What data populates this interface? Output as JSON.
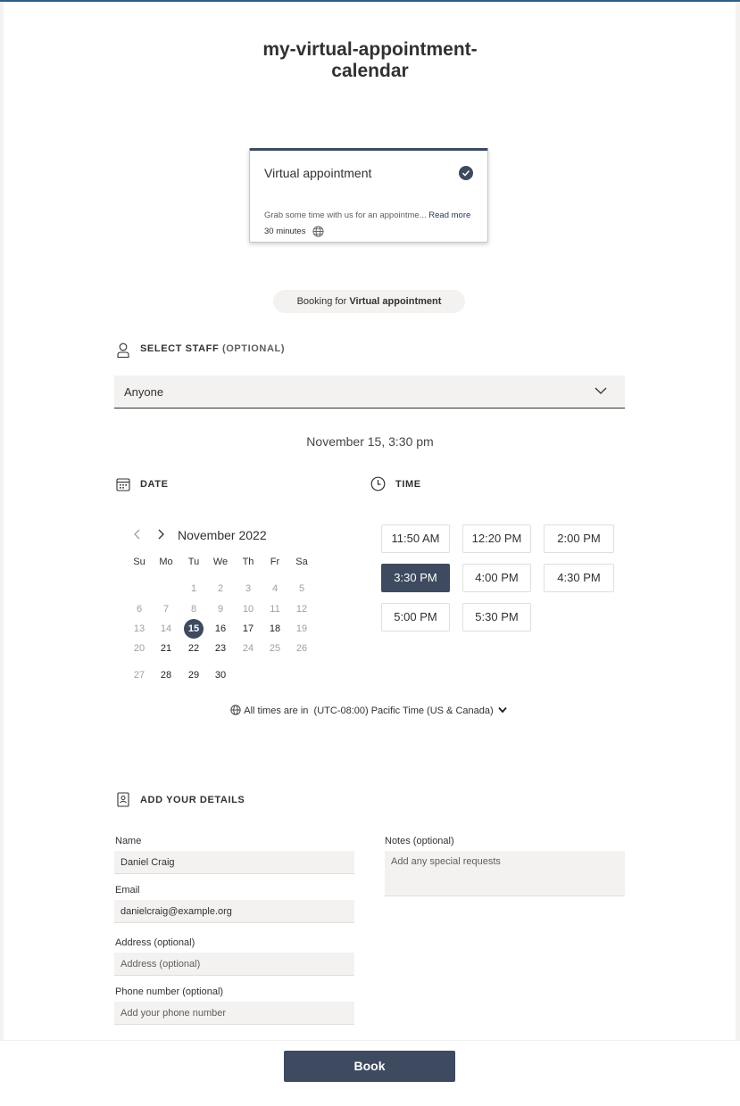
{
  "page": {
    "title_line1": "my-virtual-appointment-",
    "title_line2": "calendar"
  },
  "service": {
    "name": "Virtual appointment",
    "description": "Grab some time with us for an appointme...",
    "read_more": "Read more",
    "duration": "30 minutes",
    "selected": true
  },
  "booking_for": {
    "prefix": "Booking for",
    "service": "Virtual appointment"
  },
  "staff": {
    "heading": "SELECT STAFF",
    "heading_optional": "(OPTIONAL)",
    "value": "Anyone"
  },
  "selected_datetime": "November 15, 3:30 pm",
  "date_section": {
    "heading": "DATE"
  },
  "time_section": {
    "heading": "TIME"
  },
  "calendar": {
    "month": "November 2022",
    "weekdays": [
      "Su",
      "Mo",
      "Tu",
      "We",
      "Th",
      "Fr",
      "Sa"
    ],
    "selected_day": "15",
    "weeks": [
      [
        null,
        null,
        {
          "d": "1",
          "a": false
        },
        {
          "d": "2",
          "a": false
        },
        {
          "d": "3",
          "a": false
        },
        {
          "d": "4",
          "a": false
        },
        {
          "d": "5",
          "a": false
        }
      ],
      [
        {
          "d": "6",
          "a": false
        },
        {
          "d": "7",
          "a": false
        },
        {
          "d": "8",
          "a": false
        },
        {
          "d": "9",
          "a": false
        },
        {
          "d": "10",
          "a": false
        },
        {
          "d": "11",
          "a": false
        },
        {
          "d": "12",
          "a": false
        }
      ],
      [
        {
          "d": "13",
          "a": false
        },
        {
          "d": "14",
          "a": false
        },
        {
          "d": "15",
          "a": true
        },
        {
          "d": "16",
          "a": true
        },
        {
          "d": "17",
          "a": true
        },
        {
          "d": "18",
          "a": true
        },
        {
          "d": "19",
          "a": false
        }
      ],
      [
        {
          "d": "20",
          "a": false
        },
        {
          "d": "21",
          "a": true
        },
        {
          "d": "22",
          "a": true
        },
        {
          "d": "23",
          "a": true
        },
        {
          "d": "24",
          "a": false
        },
        {
          "d": "25",
          "a": false
        },
        {
          "d": "26",
          "a": false
        }
      ],
      [
        {
          "d": "27",
          "a": false
        },
        {
          "d": "28",
          "a": true
        },
        {
          "d": "29",
          "a": true
        },
        {
          "d": "30",
          "a": true
        },
        null,
        null,
        null
      ]
    ]
  },
  "time_slots": [
    "11:50 AM",
    "12:20 PM",
    "2:00 PM",
    "3:30 PM",
    "4:00 PM",
    "4:30 PM",
    "5:00 PM",
    "5:30 PM"
  ],
  "selected_slot": "3:30 PM",
  "timezone": {
    "prefix": "All times are in",
    "value": "(UTC-08:00) Pacific Time (US & Canada)"
  },
  "details": {
    "heading": "ADD YOUR DETAILS",
    "name_label": "Name",
    "name_value": "Daniel Craig",
    "email_label": "Email",
    "email_value": "danielcraig@example.org",
    "address_label": "Address (optional)",
    "address_placeholder": "Address (optional)",
    "phone_label": "Phone number (optional)",
    "phone_placeholder": "Add your phone number",
    "notes_label": "Notes (optional)",
    "notes_placeholder": "Add any special requests"
  },
  "book_button": "Book",
  "colors": {
    "accent": "#3d4a5f",
    "top_bar": "#2b5f87",
    "field_bg": "#f3f2f1"
  }
}
